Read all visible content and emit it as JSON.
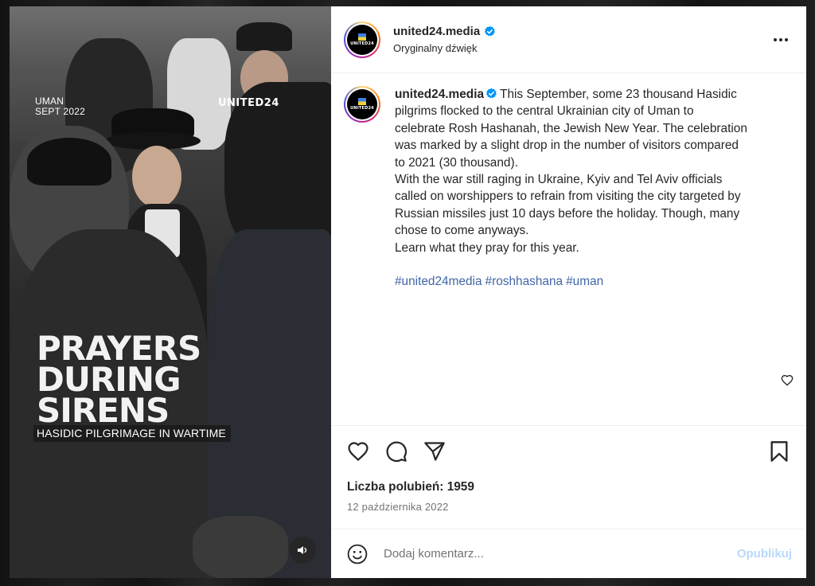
{
  "media": {
    "location_line1": "UMAN",
    "location_line2": "SEPT 2022",
    "brand": "UNITED24",
    "headline_line1": "PRAYERS",
    "headline_line2": "DURING",
    "headline_line3": "SIRENS",
    "subhead": "HASIDIC PILGRIMAGE IN WARTIME",
    "sound_icon": "speaker-icon"
  },
  "header": {
    "username": "united24.media",
    "audio": "Oryginalny dźwięk",
    "avatar_text": "UNITED24",
    "more_icon": "more-dots-icon"
  },
  "caption": {
    "username": "united24.media",
    "lines": [
      "This September, some 23 thousand Hasidic",
      "pilgrims flocked to the central Ukrainian city of Uman to",
      "celebrate Rosh Hashanah, the Jewish New Year. The celebration",
      "was marked by a slight drop in the number of visitors compared",
      "to 2021 (30 thousand).",
      "With the war still raging in Ukraine, Kyiv and Tel Aviv officials",
      "called on worshippers to refrain from visiting the city targeted by",
      "Russian missiles just 10 days before the holiday. Though, many",
      "chose to come anyways.",
      "Learn what they pray for this year."
    ],
    "hashtags": [
      "#united24media",
      "#roshhashana",
      "#uman"
    ]
  },
  "stats": {
    "likes": "Liczba polubień: 1959",
    "date": "12 października 2022"
  },
  "comment": {
    "placeholder": "Dodaj komentarz...",
    "publish": "Opublikuj"
  },
  "colors": {
    "verified": "#0095f6",
    "hashtag": "#4066a8",
    "publish_disabled": "#b8d8fb"
  }
}
